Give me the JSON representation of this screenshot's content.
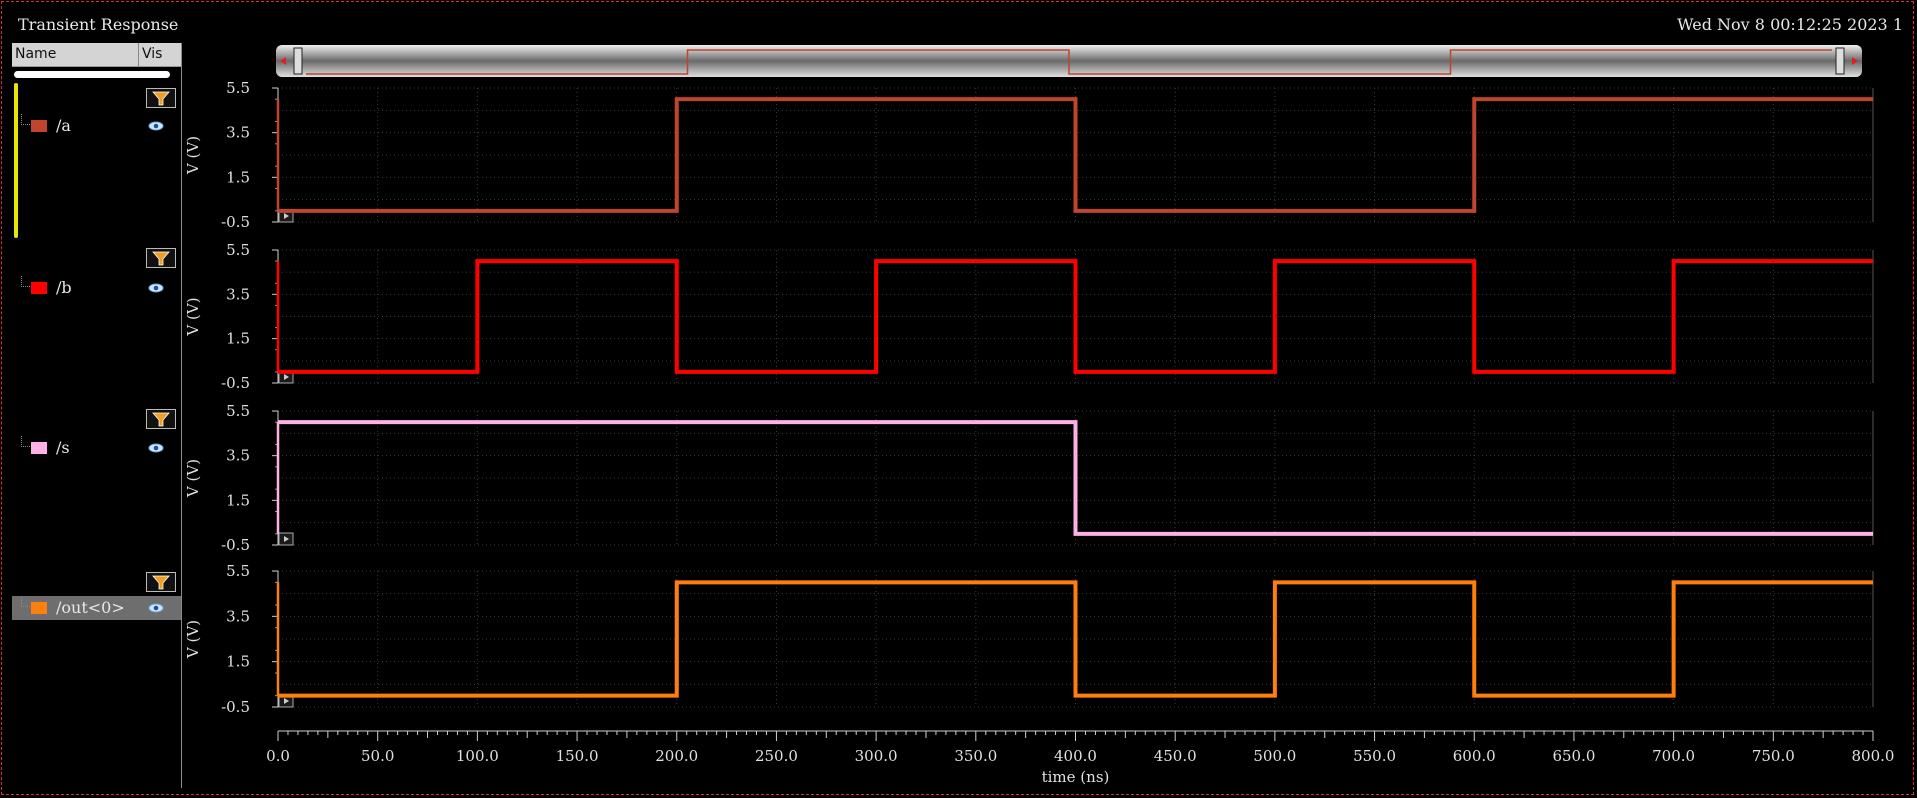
{
  "window": {
    "title": "Transient Response",
    "timestamp": "Wed Nov 8 00:12:25 2023  1"
  },
  "signal_panel": {
    "columns": {
      "name": "Name",
      "vis": "Vis"
    },
    "signals": [
      {
        "label": "/a",
        "color": "#c0452e",
        "selected": false
      },
      {
        "label": "/b",
        "color": "#ff0000",
        "selected": false
      },
      {
        "label": "/s",
        "color": "#ffb0e6",
        "selected": false
      },
      {
        "label": "/out<0>",
        "color": "#ff7f0e",
        "selected": true
      }
    ]
  },
  "chart_data": {
    "type": "line",
    "xlabel": "time (ns)",
    "xlim": [
      0,
      800
    ],
    "x_ticks": [
      "0.0",
      "50.0",
      "100.0",
      "150.0",
      "200.0",
      "250.0",
      "300.0",
      "350.0",
      "400.0",
      "450.0",
      "500.0",
      "550.0",
      "600.0",
      "650.0",
      "700.0",
      "750.0",
      "800.0"
    ],
    "ylabel": "V (V)",
    "ylim": [
      -0.5,
      5.5
    ],
    "y_ticks": [
      "5.5",
      "3.5",
      "1.5",
      "-0.5"
    ],
    "grid": true,
    "series": [
      {
        "name": "/a",
        "color": "#c0452e",
        "x": [
          0,
          200,
          200,
          400,
          400,
          600,
          600,
          800
        ],
        "y": [
          0,
          0,
          5,
          5,
          0,
          0,
          5,
          5
        ]
      },
      {
        "name": "/b",
        "color": "#ff0000",
        "x": [
          0,
          100,
          100,
          200,
          200,
          300,
          300,
          400,
          400,
          500,
          500,
          600,
          600,
          700,
          700,
          800
        ],
        "y": [
          0,
          0,
          5,
          5,
          0,
          0,
          5,
          5,
          0,
          0,
          5,
          5,
          0,
          0,
          5,
          5
        ]
      },
      {
        "name": "/s",
        "color": "#ffb0e6",
        "x": [
          0,
          400,
          400,
          800
        ],
        "y": [
          5,
          5,
          0,
          0
        ]
      },
      {
        "name": "/out<0>",
        "color": "#ff7f0e",
        "x": [
          0,
          200,
          200,
          400,
          400,
          500,
          500,
          600,
          600,
          700,
          700,
          800
        ],
        "y": [
          0,
          0,
          5,
          5,
          0,
          0,
          5,
          5,
          0,
          0,
          5,
          5
        ]
      }
    ]
  }
}
